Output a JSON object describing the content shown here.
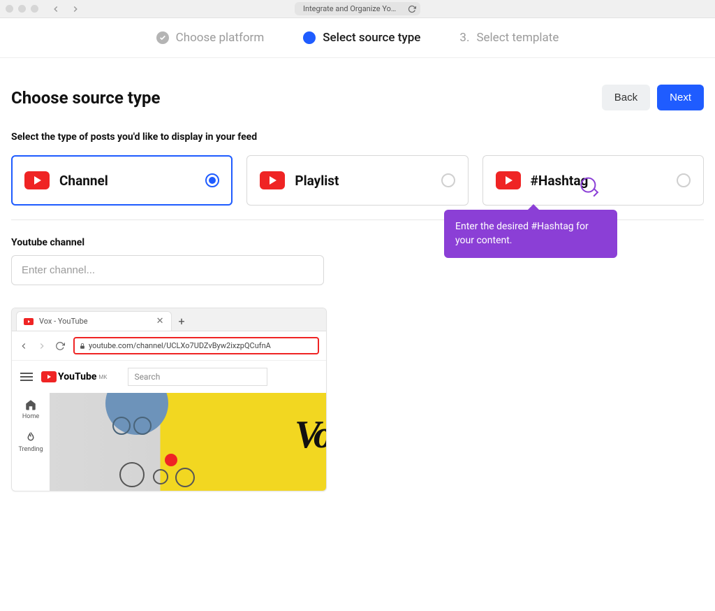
{
  "browser": {
    "address": "Integrate and Organize Yo…"
  },
  "stepper": {
    "done_label": "Choose platform",
    "active_label": "Select source type",
    "future_num": "3.",
    "future_label": "Select template"
  },
  "header": {
    "title": "Choose source type",
    "back": "Back",
    "next": "Next"
  },
  "section_label": "Select the type of posts you'd like to display in your feed",
  "sources": {
    "channel": "Channel",
    "playlist": "Playlist",
    "hashtag": "#Hashtag"
  },
  "tooltip": "Enter the desired #Hashtag for your content.",
  "field": {
    "label": "Youtube channel",
    "placeholder": "Enter channel..."
  },
  "example": {
    "tab_title": "Vox - YouTube",
    "url": "youtube.com/channel/UCLXo7UDZvByw2ixzpQCufnA",
    "logo_text": "YouTube",
    "logo_sup": "MK",
    "search_placeholder": "Search",
    "side_home": "Home",
    "side_trending": "Trending",
    "vox": "Vo"
  }
}
